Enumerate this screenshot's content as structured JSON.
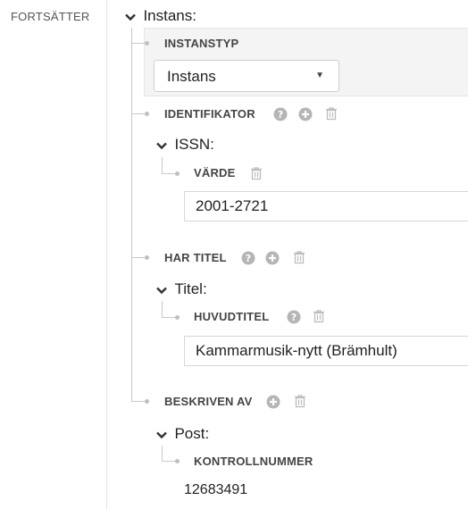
{
  "sidebar": {
    "property_label": "FORTSÄTTER"
  },
  "root": {
    "heading": "Instans:",
    "instanstyp": {
      "label": "INSTANSTYP",
      "selected": "Instans"
    },
    "identifikator": {
      "label": "IDENTIFIKATOR",
      "child_heading": "ISSN:",
      "field_label": "VÄRDE",
      "value": "2001-2721"
    },
    "har_titel": {
      "label": "HAR TITEL",
      "child_heading": "Titel:",
      "field_label": "HUVUDTITEL",
      "value": "Kammarmusik-nytt (Brämhult)"
    },
    "beskriven_av": {
      "label": "BESKRIVEN AV",
      "child_heading": "Post:",
      "field_label": "KONTROLLNUMMER",
      "value": "12683491"
    }
  },
  "colors": {
    "icon_gray": "#b5b5b5",
    "line_gray": "#c8c8c8",
    "panel_bg": "#f4f4f4"
  },
  "icons": [
    "chevron-down-icon",
    "help-icon",
    "add-icon",
    "trash-icon",
    "caret-down-icon"
  ]
}
